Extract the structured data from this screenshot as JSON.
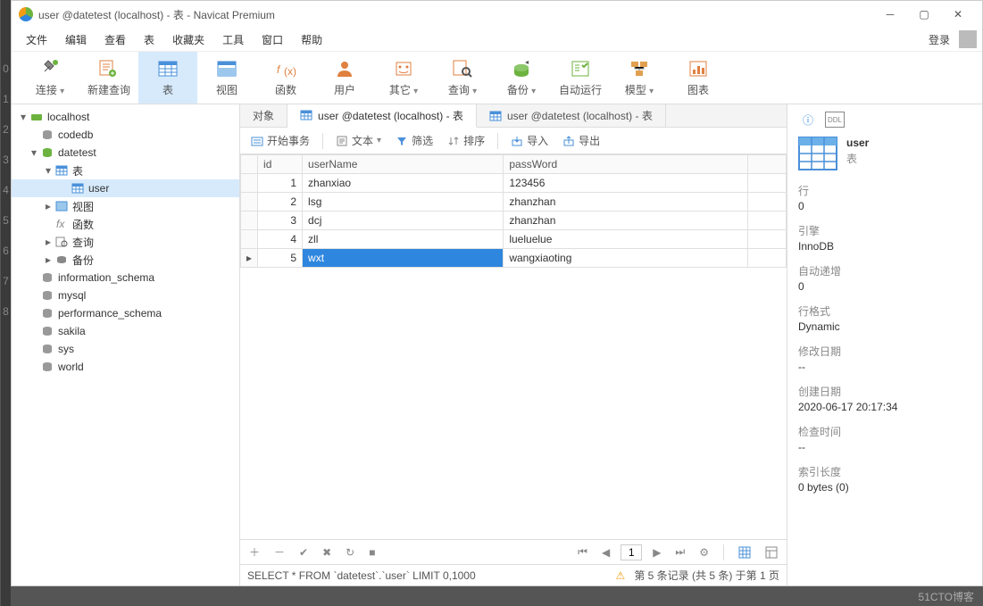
{
  "title": "user @datetest (localhost) - 表 - Navicat Premium",
  "leftStrip": [
    "0",
    "1",
    "2",
    "3",
    "4",
    "5",
    "6",
    "7",
    "8"
  ],
  "menu": [
    "文件",
    "编辑",
    "查看",
    "表",
    "收藏夹",
    "工具",
    "窗口",
    "帮助"
  ],
  "login": "登录",
  "ribbon": [
    {
      "label": "连接",
      "icon": "plug",
      "dd": true
    },
    {
      "label": "新建查询",
      "icon": "newquery"
    },
    {
      "label": "表",
      "icon": "table",
      "selected": true
    },
    {
      "label": "视图",
      "icon": "view"
    },
    {
      "label": "函数",
      "icon": "fx"
    },
    {
      "label": "用户",
      "icon": "user"
    },
    {
      "label": "其它",
      "icon": "other",
      "dd": true
    },
    {
      "label": "查询",
      "icon": "query",
      "dd": true
    },
    {
      "label": "备份",
      "icon": "backup",
      "dd": true
    },
    {
      "label": "自动运行",
      "icon": "auto"
    },
    {
      "label": "模型",
      "icon": "model",
      "dd": true
    },
    {
      "label": "图表",
      "icon": "chart"
    }
  ],
  "tree": [
    {
      "d": 0,
      "tw": "▾",
      "icon": "conn",
      "label": "localhost"
    },
    {
      "d": 1,
      "tw": "",
      "icon": "db",
      "label": "codedb"
    },
    {
      "d": 1,
      "tw": "▾",
      "icon": "dbopen",
      "label": "datetest"
    },
    {
      "d": 2,
      "tw": "▾",
      "icon": "table",
      "label": "表",
      "sel": false
    },
    {
      "d": 3,
      "tw": "",
      "icon": "table",
      "label": "user",
      "sel": true
    },
    {
      "d": 2,
      "tw": "▸",
      "icon": "view",
      "label": "视图"
    },
    {
      "d": 2,
      "tw": "",
      "icon": "fx",
      "label": "函数"
    },
    {
      "d": 2,
      "tw": "▸",
      "icon": "query",
      "label": "查询"
    },
    {
      "d": 2,
      "tw": "▸",
      "icon": "backup",
      "label": "备份"
    },
    {
      "d": 1,
      "tw": "",
      "icon": "db",
      "label": "information_schema"
    },
    {
      "d": 1,
      "tw": "",
      "icon": "db",
      "label": "mysql"
    },
    {
      "d": 1,
      "tw": "",
      "icon": "db",
      "label": "performance_schema"
    },
    {
      "d": 1,
      "tw": "",
      "icon": "db",
      "label": "sakila"
    },
    {
      "d": 1,
      "tw": "",
      "icon": "db",
      "label": "sys"
    },
    {
      "d": 1,
      "tw": "",
      "icon": "db",
      "label": "world"
    }
  ],
  "tabs": [
    {
      "label": "对象",
      "active": false
    },
    {
      "label": "user @datetest (localhost) - 表",
      "active": true,
      "icon": "table"
    },
    {
      "label": "user @datetest (localhost) - 表",
      "active": false,
      "icon": "table-gray"
    }
  ],
  "toolbar": {
    "begin": "开始事务",
    "text": "文本",
    "filter": "筛选",
    "sort": "排序",
    "import": "导入",
    "export": "导出"
  },
  "columns": [
    "id",
    "userName",
    "passWord"
  ],
  "rows": [
    {
      "id": 1,
      "userName": "zhanxiao",
      "passWord": "123456",
      "sel": false
    },
    {
      "id": 2,
      "userName": "lsg",
      "passWord": "zhanzhan",
      "sel": false
    },
    {
      "id": 3,
      "userName": "dcj",
      "passWord": "zhanzhan",
      "sel": false
    },
    {
      "id": 4,
      "userName": "zll",
      "passWord": "lueluelue",
      "sel": false
    },
    {
      "id": 5,
      "userName": "wxt",
      "passWord": "wangxiaoting",
      "sel": true
    }
  ],
  "pager": {
    "page": "1"
  },
  "sql": "SELECT * FROM `datetest`.`user` LIMIT 0,1000",
  "recordInfo": "第 5 条记录  (共 5 条)  于第 1 页",
  "detail": {
    "name": "user",
    "type": "表",
    "props": [
      {
        "k": "行",
        "v": "0"
      },
      {
        "k": "引擎",
        "v": "InnoDB"
      },
      {
        "k": "自动递增",
        "v": "0"
      },
      {
        "k": "行格式",
        "v": "Dynamic"
      },
      {
        "k": "修改日期",
        "v": "--"
      },
      {
        "k": "创建日期",
        "v": "2020-06-17 20:17:34"
      },
      {
        "k": "检查时间",
        "v": "--"
      },
      {
        "k": "索引长度",
        "v": "0 bytes (0)"
      }
    ]
  },
  "footer": {
    "right": "51CTO博客"
  }
}
